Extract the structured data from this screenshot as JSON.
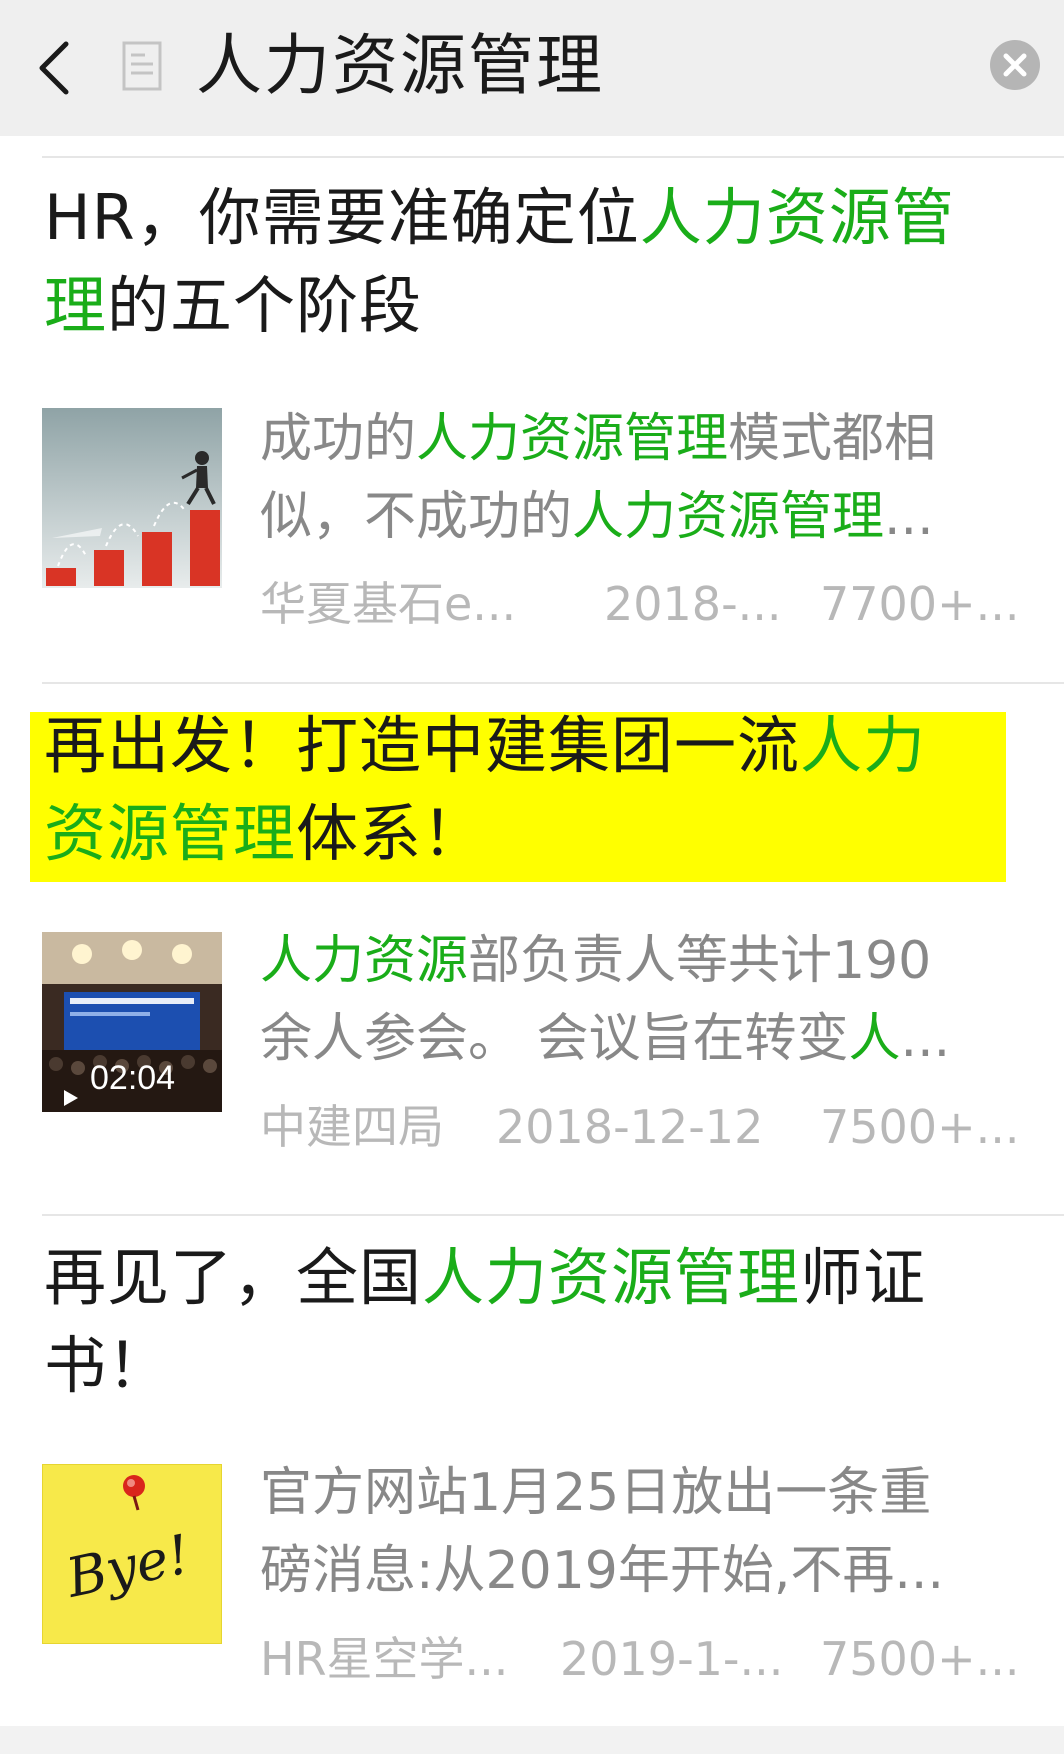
{
  "header": {
    "title": "人力资源管理",
    "back_icon": "chevron-left-icon",
    "doc_icon": "document-icon",
    "close_icon": "close-icon"
  },
  "colors": {
    "highlight_text": "#1aad19",
    "title_highlight_bg": "#ffff00",
    "meta_text": "#b8b8b8",
    "snippet_text": "#888888"
  },
  "articles": [
    {
      "title_parts": [
        {
          "text": "HR，你需要准确定位",
          "hl": false
        },
        {
          "text": "人力资源管理",
          "hl": true
        },
        {
          "text": "的五个阶段",
          "hl": false
        }
      ],
      "title_line1": {
        "plain": "HR，你需要准确定位",
        "hl": "人力资源管"
      },
      "title_line2": {
        "hl": "理",
        "plain": "的五个阶段"
      },
      "snippet_line1": {
        "plain1": "成功的",
        "hl": "人力资源管理",
        "plain2": "模式都相"
      },
      "snippet_line2": {
        "plain1": "似，不成功的",
        "hl": "人力资源管理",
        "plain2": "..."
      },
      "source": "华夏基石e...",
      "date": "2018-...",
      "reads": "7700+...",
      "thumb_icon": "growth-chart-icon"
    },
    {
      "title_line1": {
        "plain": "再出发！打造中建集团一流",
        "hl": "人力"
      },
      "title_line2": {
        "hl": "资源管理",
        "plain": "体系！"
      },
      "snippet_line1": {
        "hl": "人力资源",
        "plain": "部负责人等共计190"
      },
      "snippet_line2": {
        "plain": "余人参会。 会议旨在转变",
        "hl": "人",
        "plain2": "..."
      },
      "source": "中建四局",
      "date": "2018-12-12",
      "reads": "7500+...",
      "video_duration": "02:04",
      "thumb_icon": "conference-video-icon"
    },
    {
      "title_line1": {
        "plain1": "再见了，全国",
        "hl": "人力资源管理",
        "plain2": "师证"
      },
      "title_line2": {
        "plain": "书！"
      },
      "snippet_line1": "官方网站1月25日放出一条重",
      "snippet_line2": "磅消息:从2019年开始,不再...",
      "source": "HR星空学...",
      "date": "2019-1-...",
      "reads": "7500+...",
      "thumb_note_text": "Bye!",
      "thumb_icon": "sticky-note-bye-icon"
    }
  ]
}
